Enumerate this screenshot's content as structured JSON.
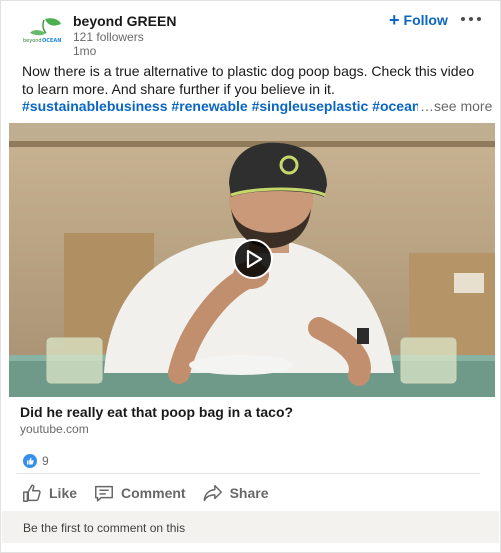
{
  "post": {
    "author": {
      "name": "beyond GREEN",
      "followers": "121 followers",
      "time": "1mo",
      "logo_text": "beyond OCEAN"
    },
    "follow_label": "Follow",
    "commentary_text": "Now there is a true alternative to plastic dog poop bags. Check this video to learn more. And share further if you believe in it.",
    "hashtags": [
      "#sustainablebusiness",
      "#renewable",
      "#singleuseplastic",
      "#oceanplasti"
    ],
    "see_more_label": "…see more",
    "link": {
      "title": "Did he really eat that poop bag in a taco?",
      "domain": "youtube.com"
    },
    "reactions": {
      "count": "9",
      "icon": "like-reaction-icon"
    },
    "actions": [
      {
        "label": "Like",
        "icon": "thumbs-up-icon"
      },
      {
        "label": "Comment",
        "icon": "comment-icon"
      },
      {
        "label": "Share",
        "icon": "share-arrow-icon"
      }
    ],
    "footer_text": "Be the first to comment on this"
  },
  "colors": {
    "link_blue": "#0a66c2",
    "muted_text": "#666666",
    "footer_bg": "#f3f2ef",
    "brand_green": "#4caf50"
  }
}
